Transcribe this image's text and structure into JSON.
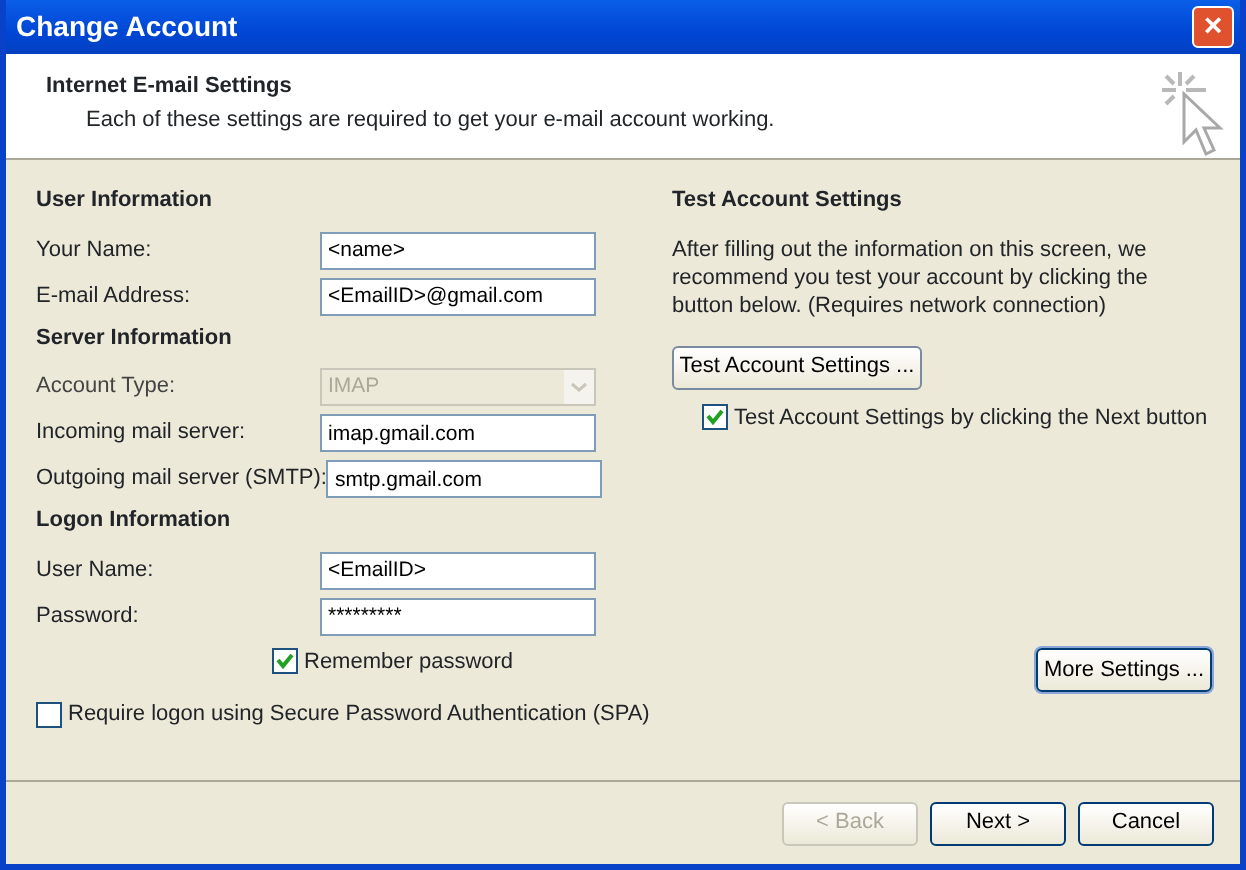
{
  "window": {
    "title": "Change Account",
    "close": "×"
  },
  "header": {
    "title": "Internet E-mail Settings",
    "subtitle": "Each of these settings are required to get your e-mail account working."
  },
  "sections": [
    {
      "heading": "User Information",
      "fields": [
        {
          "label": "Your Name:",
          "kind": "input",
          "value": "<name>",
          "disabled": false
        },
        {
          "label": "E-mail Address:",
          "kind": "input",
          "value": "<EmailID>@gmail.com",
          "disabled": false
        }
      ]
    },
    {
      "heading": "Server Information",
      "fields": [
        {
          "label": "Account Type:",
          "kind": "select",
          "value": "IMAP",
          "disabled": true
        },
        {
          "label": "Incoming mail server:",
          "kind": "input",
          "value": "imap.gmail.com",
          "disabled": false
        },
        {
          "label": "Outgoing mail server (SMTP):",
          "kind": "input",
          "value": "smtp.gmail.com",
          "disabled": false
        }
      ]
    },
    {
      "heading": "Logon Information",
      "fields": [
        {
          "label": "User Name:",
          "kind": "input",
          "value": "<EmailID>",
          "disabled": false
        },
        {
          "label": "Password:",
          "kind": "input",
          "value": "*********",
          "disabled": false
        }
      ]
    }
  ],
  "remember_password": {
    "label": "Remember password",
    "checked": true
  },
  "spa": {
    "label": "Require logon using Secure Password Authentication (SPA)",
    "checked": false
  },
  "test": {
    "heading": "Test Account Settings",
    "description": "After filling out the information on this screen, we recommend you test your account by clicking the button below. (Requires network connection)",
    "button": "Test Account Settings ...",
    "checkbox": {
      "label": "Test Account Settings by clicking the Next button",
      "checked": true
    }
  },
  "more_settings": "More Settings ...",
  "buttons": [
    {
      "label": "< Back",
      "disabled": true,
      "default": false
    },
    {
      "label": "Next >",
      "disabled": false,
      "default": false
    },
    {
      "label": "Cancel",
      "disabled": false,
      "default": false
    }
  ]
}
